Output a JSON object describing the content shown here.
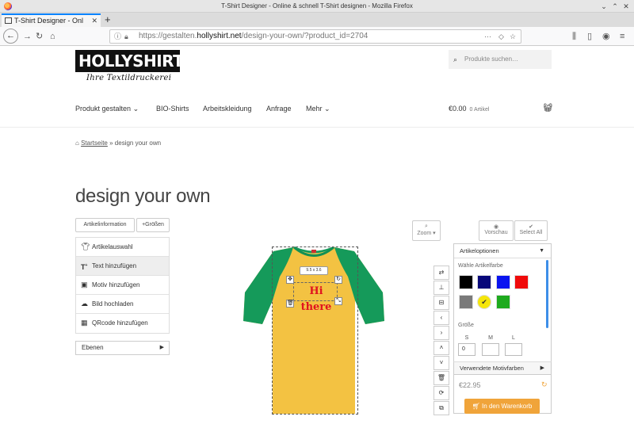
{
  "window": {
    "title": "T-Shirt Designer - Online & schnell T-Shirt designen - Mozilla Firefox"
  },
  "browser": {
    "tab_title": "T-Shirt Designer - Onl",
    "new_tab": "+",
    "url_prefix": "https://gestalten.",
    "url_domain": "hollyshirt.net",
    "url_path": "/design-your-own/?product_id=2704"
  },
  "site": {
    "logo": "HOLLYSHIRT",
    "logo_reg": "®",
    "tagline": "Ihre Textildruckerei",
    "search_placeholder": "Produkte suchen…",
    "nav": [
      "Produkt gestalten",
      "BIO-Shirts",
      "Arbeitskleidung",
      "Anfrage",
      "Mehr"
    ],
    "cart_total": "€0.00",
    "cart_count": "0 Artikel",
    "breadcrumb_home": "Startseite",
    "breadcrumb_sep": "»",
    "breadcrumb_current": "design your own",
    "page_title": "design your own"
  },
  "designer": {
    "btn_artikelinfo": "Artikelinformation",
    "btn_groessen": "+Größen",
    "menu": [
      {
        "label": "Artikelauswahl",
        "icon": "shirt-icon"
      },
      {
        "label": "Text hinzufügen",
        "icon": "text-add-icon"
      },
      {
        "label": "Motiv hinzufügen",
        "icon": "image-icon"
      },
      {
        "label": "Bild hochladen",
        "icon": "cloud-upload-icon"
      },
      {
        "label": "QRcode hinzufügen",
        "icon": "qrcode-icon"
      }
    ],
    "ebenen": "Ebenen",
    "dimension": "9.5 x 3.6",
    "text": "Hi there",
    "zoom": "Zoom",
    "vorschau": "Vorschau",
    "select_all": "Select All",
    "panel_title": "Artikeloptionen",
    "color_label": "Wähle Artikelfarbe",
    "colors": [
      "#000000",
      "#08087a",
      "#0a14f0",
      "#f00a0a",
      "#7a7a7a",
      "#f5e60a",
      "#1eaa1e"
    ],
    "size_label": "Größe",
    "sizes": [
      {
        "name": "S",
        "value": "0"
      },
      {
        "name": "M",
        "value": ""
      },
      {
        "name": "L",
        "value": ""
      }
    ],
    "motiv_label": "Verwendete Motivfarben",
    "price": "€22.95",
    "add_to_cart": "In den Warenkorb"
  }
}
